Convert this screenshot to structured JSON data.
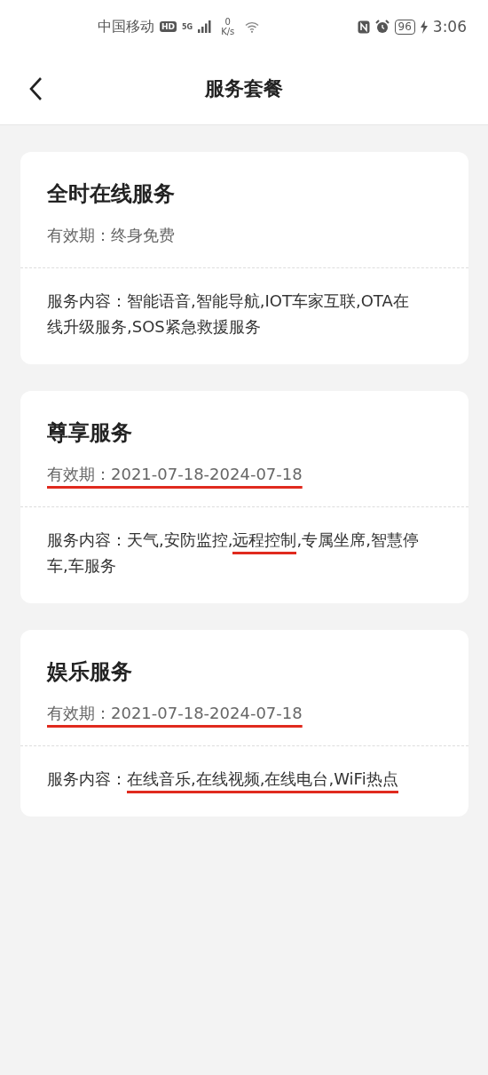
{
  "status_bar": {
    "carrier": "中国移动",
    "hd_badge": "HD",
    "network": "5G",
    "speed_value": "0",
    "speed_unit": "K/s",
    "battery": "96",
    "time": "3:06"
  },
  "header": {
    "title": "服务套餐"
  },
  "cards": [
    {
      "title": "全时在线服务",
      "validity": "有效期：终身免费",
      "validity_underlined": false,
      "content": {
        "label": "服务内容：",
        "separator": ",",
        "items": [
          {
            "text": "智能语音",
            "underlined": false
          },
          {
            "text": "智能导航",
            "underlined": false
          },
          {
            "text": "IOT车家互联",
            "underlined": false
          },
          {
            "text": "OTA在线升级服务",
            "underlined": false
          },
          {
            "text": "SOS紧急救援服务",
            "underlined": false
          }
        ]
      }
    },
    {
      "title": "尊享服务",
      "validity": "有效期：2021-07-18-2024-07-18",
      "validity_underlined": true,
      "content": {
        "label": "服务内容：",
        "separator": ",",
        "items": [
          {
            "text": "天气",
            "underlined": false
          },
          {
            "text": "安防监控",
            "underlined": false
          },
          {
            "text": "远程控制",
            "underlined": true
          },
          {
            "text": "专属坐席",
            "underlined": false
          },
          {
            "text": "智慧停车",
            "underlined": false
          },
          {
            "text": "车服务",
            "underlined": false
          }
        ]
      }
    },
    {
      "title": "娱乐服务",
      "validity": "有效期：2021-07-18-2024-07-18",
      "validity_underlined": true,
      "content": {
        "label": "服务内容：",
        "separator": ",",
        "items": [
          {
            "text": "在线音乐",
            "underlined": true
          },
          {
            "text": "在线视频",
            "underlined": true
          },
          {
            "text": "在线电台",
            "underlined": true
          },
          {
            "text": "WiFi热点",
            "underlined": true
          }
        ]
      }
    }
  ]
}
